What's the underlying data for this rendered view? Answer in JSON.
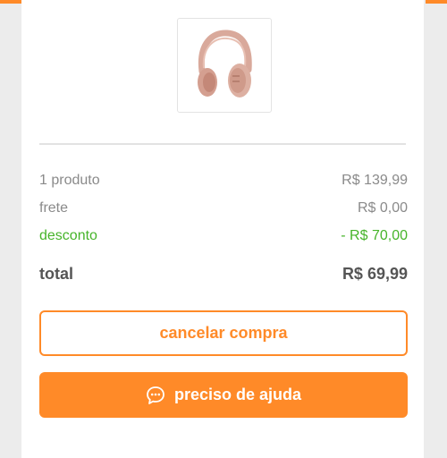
{
  "colors": {
    "accent": "#ff8a28",
    "discount": "#46b42a",
    "muted_text": "#8a8a8a",
    "strong_text": "#555555",
    "background": "#ececec"
  },
  "product": {
    "image_icon": "headphones-product-image"
  },
  "summary": {
    "products_label": "1 produto",
    "products_value": "R$ 139,99",
    "shipping_label": "frete",
    "shipping_value": "R$ 0,00",
    "discount_label": "desconto",
    "discount_value": "- R$ 70,00",
    "total_label": "total",
    "total_value": "R$ 69,99"
  },
  "actions": {
    "cancel_label": "cancelar compra",
    "help_label": "preciso de ajuda",
    "help_icon": "chat-bubble-icon"
  }
}
